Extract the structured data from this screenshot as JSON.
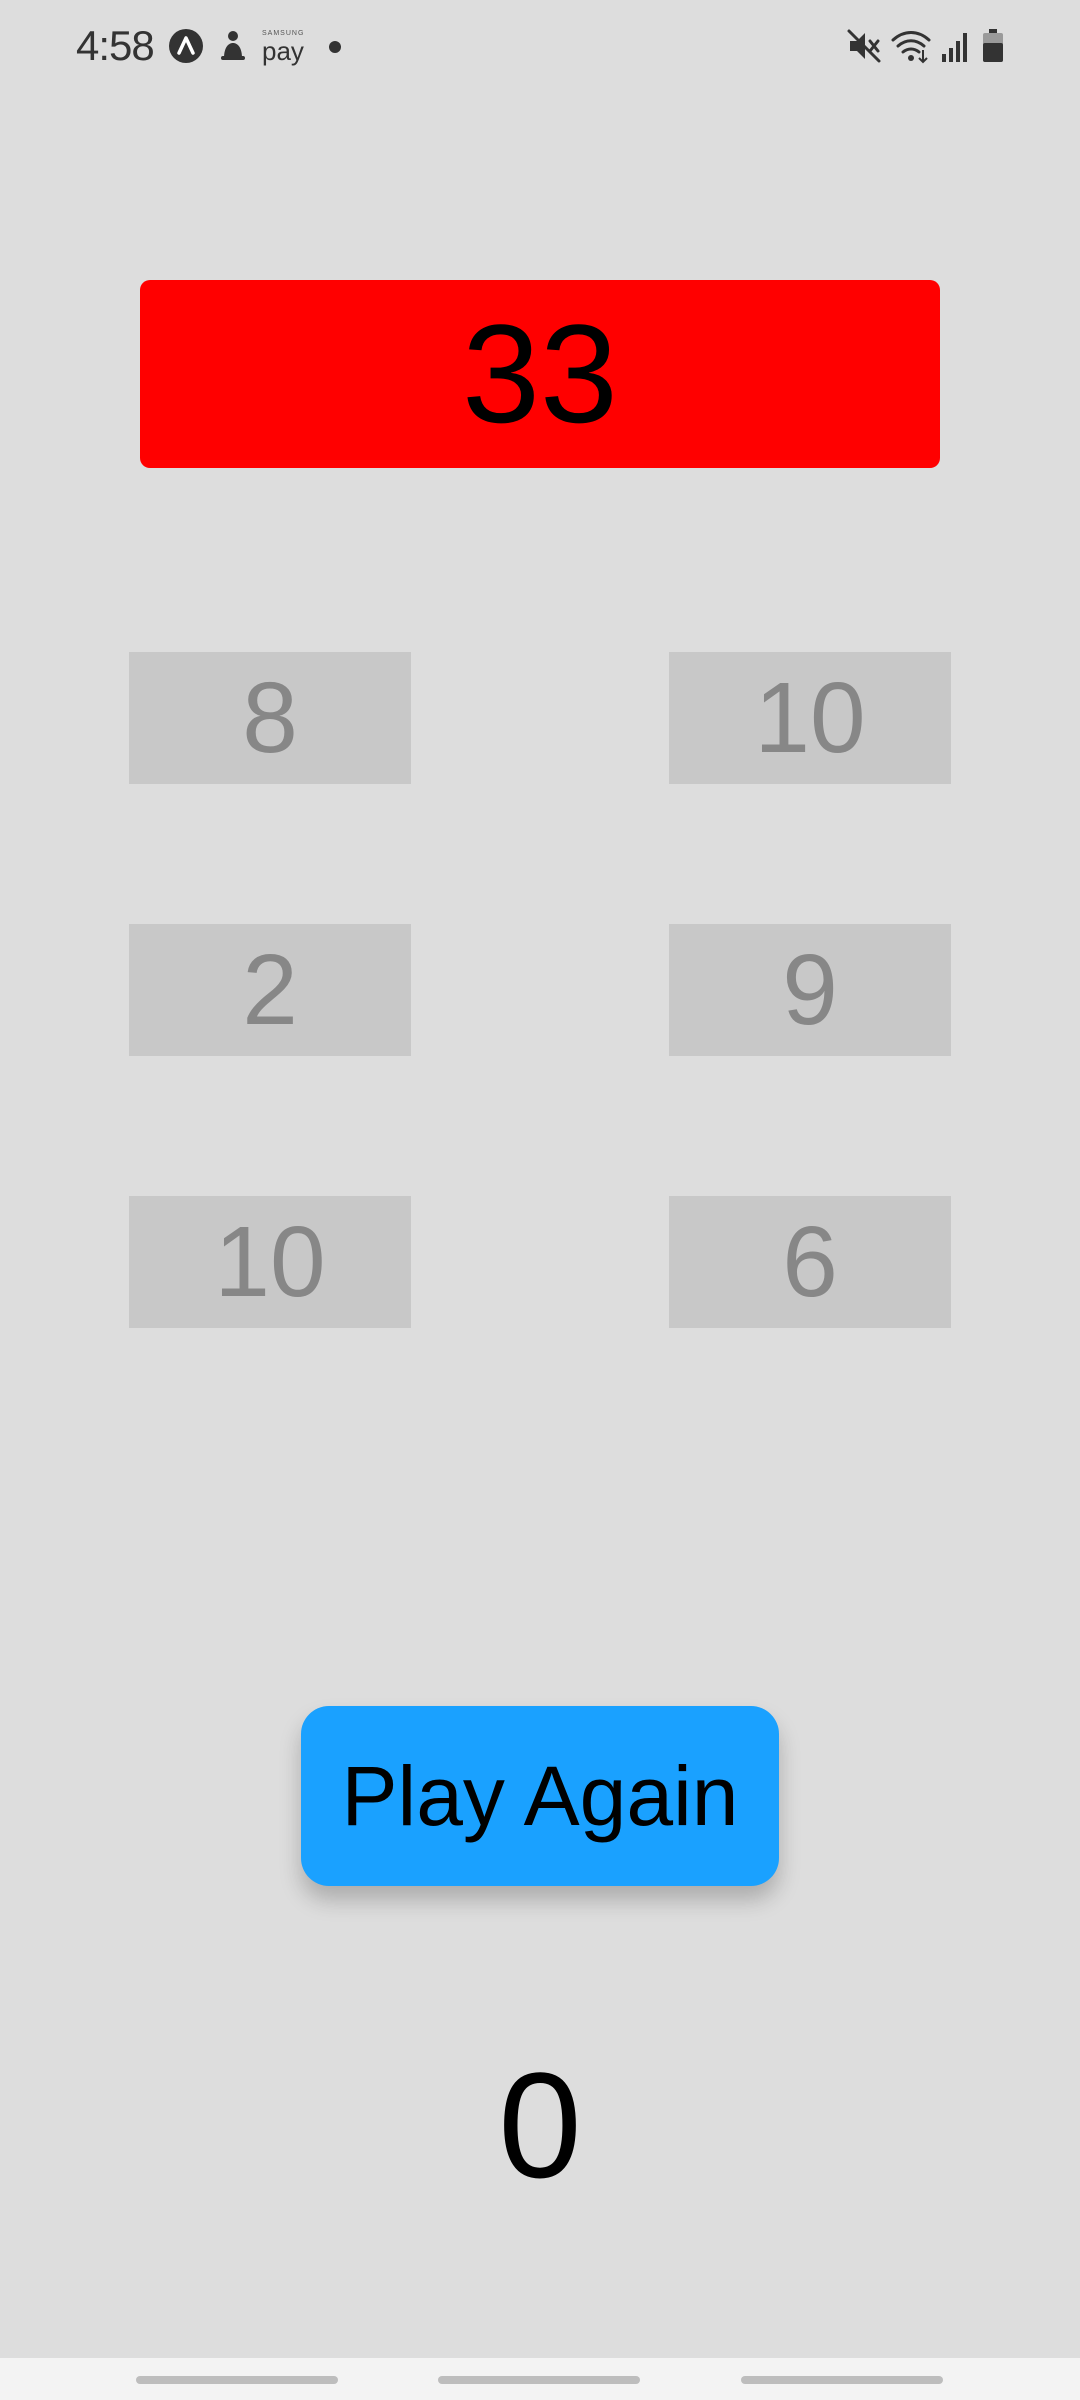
{
  "status_bar": {
    "time": "4:58",
    "pay_brand": "SAMSUNG",
    "pay_label": "pay",
    "icons": [
      "app-a-icon",
      "person-icon",
      "samsung-pay-icon",
      "notification-dot-icon",
      "mute-icon",
      "wifi-icon",
      "signal-icon",
      "battery-icon"
    ]
  },
  "game": {
    "target": "33",
    "target_color": "#ff0000",
    "tiles": [
      "8",
      "10",
      "2",
      "9",
      "10",
      "6"
    ],
    "play_again_label": "Play Again",
    "button_color": "#1aa1ff",
    "score": "0"
  }
}
